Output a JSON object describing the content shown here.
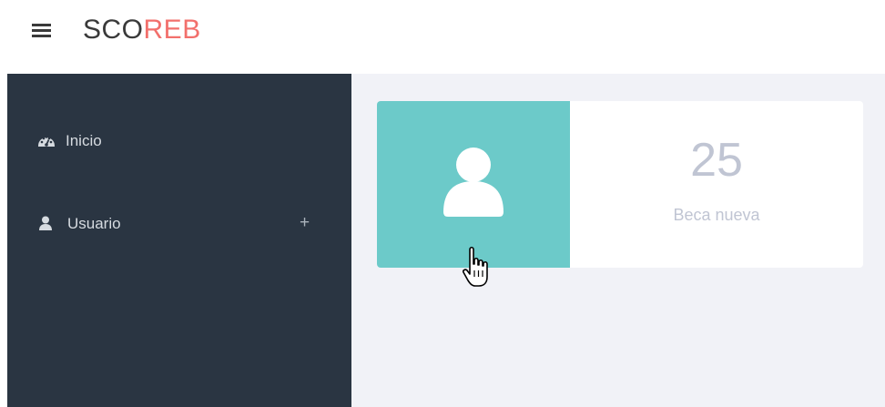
{
  "header": {
    "brand_part1": "SCO",
    "brand_part2": "REB",
    "brand_part2_color": "#f2706c",
    "menu_icon": "hamburger-menu-icon"
  },
  "sidebar": {
    "background": "#2a3542",
    "items": [
      {
        "label": "Inicio",
        "icon": "dashboard-gauge-icon"
      },
      {
        "label": "Usuario",
        "icon": "user-icon",
        "expand_symbol": "+"
      }
    ]
  },
  "main": {
    "stat_card": {
      "icon": "user-icon",
      "icon_panel_color": "#6ccac9",
      "value": "25",
      "label": "Beca nueva"
    }
  },
  "cursor": {
    "type": "hand-pointer-icon"
  }
}
